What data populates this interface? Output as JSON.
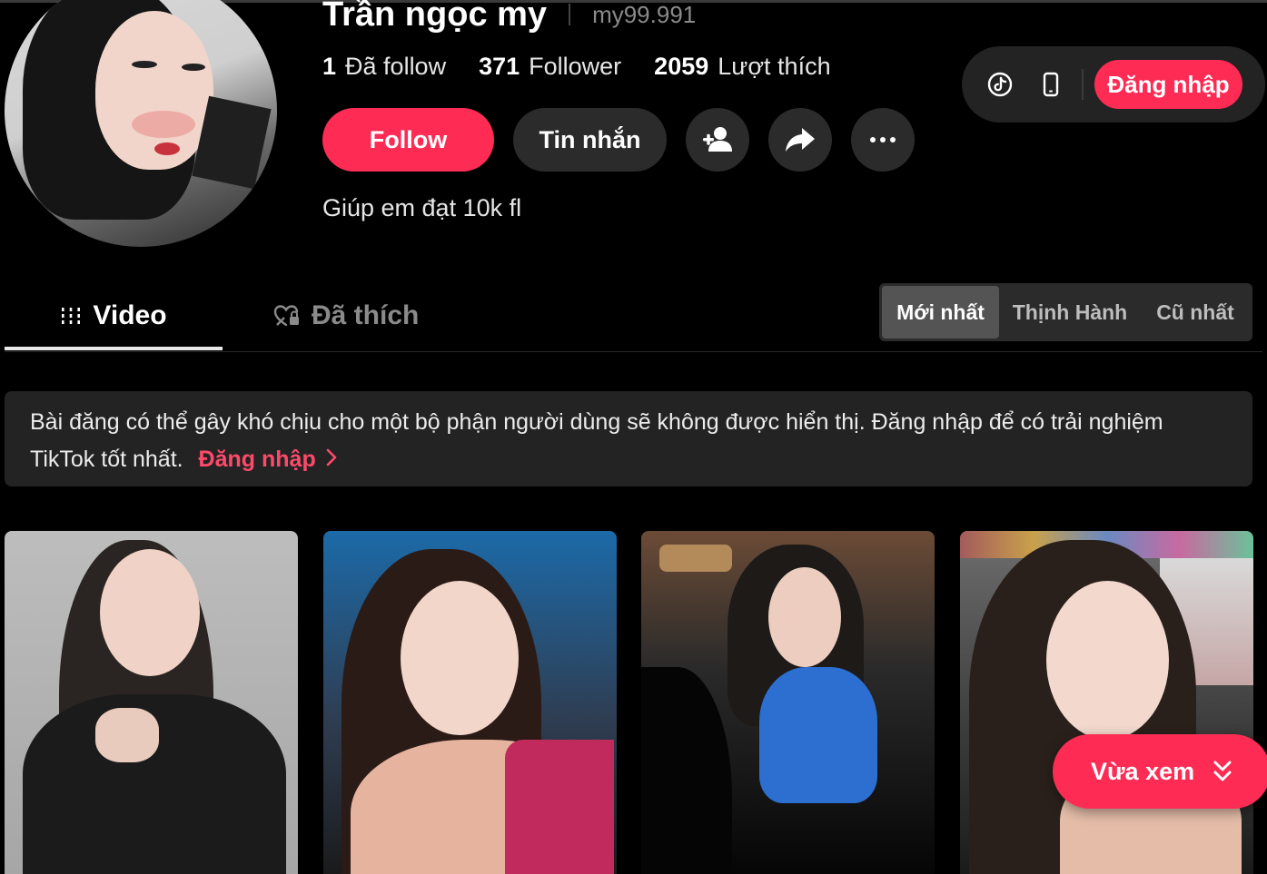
{
  "profile": {
    "display_name": "Trần ngọc my",
    "username": "my99.991",
    "bio": "Giúp em đạt 10k fl"
  },
  "stats": [
    {
      "value": "1",
      "label": "Đã follow"
    },
    {
      "value": "371",
      "label": "Follower"
    },
    {
      "value": "2059",
      "label": "Lượt thích"
    }
  ],
  "actions": {
    "follow_label": "Follow",
    "message_label": "Tin nhắn",
    "add_friend_icon": "person-add-icon",
    "share_icon": "share-arrow-icon",
    "more_icon": "more-dots-icon"
  },
  "header": {
    "tiktok_icon": "tiktok-logo-icon",
    "device_icon": "phone-icon",
    "login_label": "Đăng nhập"
  },
  "tabs": {
    "video_label": "Video",
    "liked_label": "Đã thích"
  },
  "sort": {
    "options": [
      "Mới nhất",
      "Thịnh Hành",
      "Cũ nhất"
    ],
    "selected": "Mới nhất"
  },
  "notice": {
    "text": "Bài đăng có thể gây khó chịu cho một bộ phận người dùng sẽ không được hiển thị. Đăng nhập để có trải nghiệm TikTok tốt nhất.",
    "link_label": "Đăng nhập"
  },
  "floating": {
    "recent_label": "Vừa xem"
  },
  "colors": {
    "accent": "#fe2c55",
    "background": "#000000",
    "surface": "#2b2b2b"
  }
}
